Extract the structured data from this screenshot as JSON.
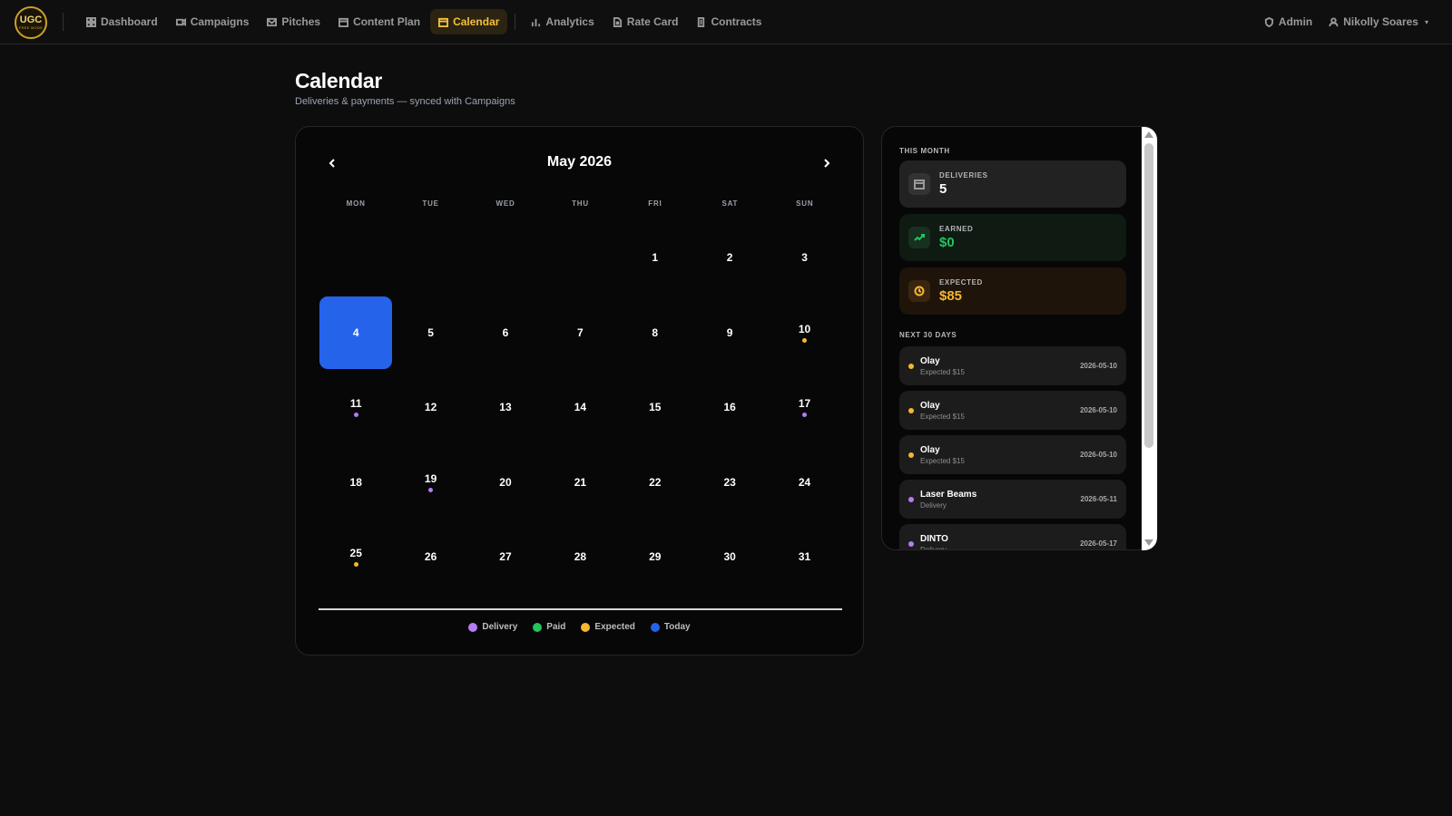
{
  "brand": {
    "logo_line1": "UGC",
    "logo_line2": "FREE MODE"
  },
  "nav": {
    "items": [
      {
        "label": "Dashboard",
        "icon": "dashboard-icon"
      },
      {
        "label": "Campaigns",
        "icon": "video-icon"
      },
      {
        "label": "Pitches",
        "icon": "mail-icon"
      },
      {
        "label": "Content Plan",
        "icon": "calendar-icon"
      },
      {
        "label": "Calendar",
        "icon": "calendar-icon",
        "active": true
      },
      {
        "label": "Analytics",
        "icon": "bar-chart-icon"
      },
      {
        "label": "Rate Card",
        "icon": "document-icon"
      },
      {
        "label": "Contracts",
        "icon": "contract-icon"
      }
    ],
    "admin": "Admin",
    "user": "Nikolly Soares"
  },
  "page": {
    "title": "Calendar",
    "subtitle": "Deliveries & payments — synced with Campaigns"
  },
  "calendar": {
    "month_label": "May 2026",
    "weekdays": [
      "MON",
      "TUE",
      "WED",
      "THU",
      "FRI",
      "SAT",
      "SUN"
    ],
    "leading_blanks": 4,
    "days_in_month": 31,
    "today": 4,
    "markers": {
      "10": "expected",
      "11": "delivery",
      "17": "delivery",
      "19": "delivery",
      "25": "expected"
    },
    "legend": [
      {
        "label": "Delivery",
        "kind": "delivery"
      },
      {
        "label": "Paid",
        "kind": "paid"
      },
      {
        "label": "Expected",
        "kind": "expected"
      },
      {
        "label": "Today",
        "kind": "today"
      }
    ]
  },
  "colors": {
    "delivery": "#b57cf6",
    "paid": "#22c55e",
    "expected": "#f5b82e",
    "today": "#2563eb",
    "accent": "#f3c03a"
  },
  "summary": {
    "section_label": "THIS MONTH",
    "deliveries": {
      "label": "DELIVERIES",
      "value": "5"
    },
    "earned": {
      "label": "EARNED",
      "value": "$0"
    },
    "expected": {
      "label": "EXPECTED",
      "value": "$85"
    }
  },
  "upcoming": {
    "section_label": "NEXT 30 DAYS",
    "items": [
      {
        "name": "Olay",
        "sub": "Expected $15",
        "date": "2026-05-10",
        "kind": "expected"
      },
      {
        "name": "Olay",
        "sub": "Expected $15",
        "date": "2026-05-10",
        "kind": "expected"
      },
      {
        "name": "Olay",
        "sub": "Expected $15",
        "date": "2026-05-10",
        "kind": "expected"
      },
      {
        "name": "Laser Beams",
        "sub": "Delivery",
        "date": "2026-05-11",
        "kind": "delivery"
      },
      {
        "name": "DINTO",
        "sub": "Delivery",
        "date": "2026-05-17",
        "kind": "delivery"
      }
    ]
  }
}
